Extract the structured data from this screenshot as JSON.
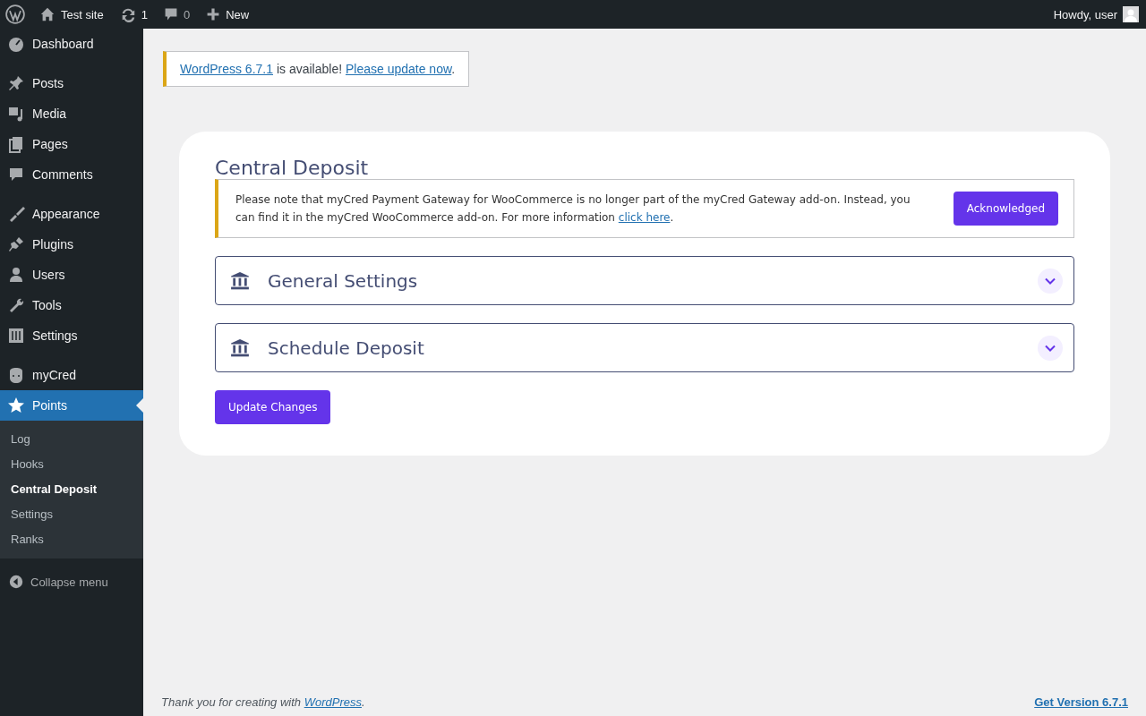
{
  "admin_bar": {
    "site": "Test site",
    "updates": "1",
    "comments": "0",
    "new": "New",
    "greeting": "Howdy, user"
  },
  "sidebar": {
    "groups": [
      [
        {
          "label": "Dashboard",
          "selected": false
        }
      ],
      [
        {
          "label": "Posts",
          "selected": false
        },
        {
          "label": "Media",
          "selected": false
        },
        {
          "label": "Pages",
          "selected": false
        },
        {
          "label": "Comments",
          "selected": false
        }
      ],
      [
        {
          "label": "Appearance",
          "selected": false
        },
        {
          "label": "Plugins",
          "selected": false
        },
        {
          "label": "Users",
          "selected": false
        },
        {
          "label": "Tools",
          "selected": false
        },
        {
          "label": "Settings",
          "selected": false
        }
      ],
      [
        {
          "label": "myCred",
          "selected": false
        },
        {
          "label": "Points",
          "selected": true,
          "children": [
            {
              "label": "Log",
              "selected": false
            },
            {
              "label": "Hooks",
              "selected": false
            },
            {
              "label": "Central Deposit",
              "selected": true
            },
            {
              "label": "Settings",
              "selected": false
            },
            {
              "label": "Ranks",
              "selected": false
            }
          ]
        }
      ]
    ],
    "collapse": "Collapse menu"
  },
  "update_notice": {
    "link": "WordPress 6.7.1",
    "text": " is available! ",
    "action": "Please update now",
    "end": "."
  },
  "panel": {
    "title": "Central Deposit",
    "notice": {
      "text": "Please note that myCred Payment Gateway for WooCommerce is no longer part of the myCred Gateway add-on. Instead, you can find it in the myCred WooCommerce add-on. For more information ",
      "link": "click here",
      "end": ".",
      "button": "Acknowledged"
    },
    "sections": [
      {
        "title": "General Settings",
        "expanded": false
      },
      {
        "title": "Schedule Deposit",
        "expanded": false
      }
    ],
    "button": "Update Changes"
  },
  "footer": {
    "text": "Thank you for creating with ",
    "link": "WordPress",
    "end": ".",
    "version": "Get Version 6.7.1"
  }
}
